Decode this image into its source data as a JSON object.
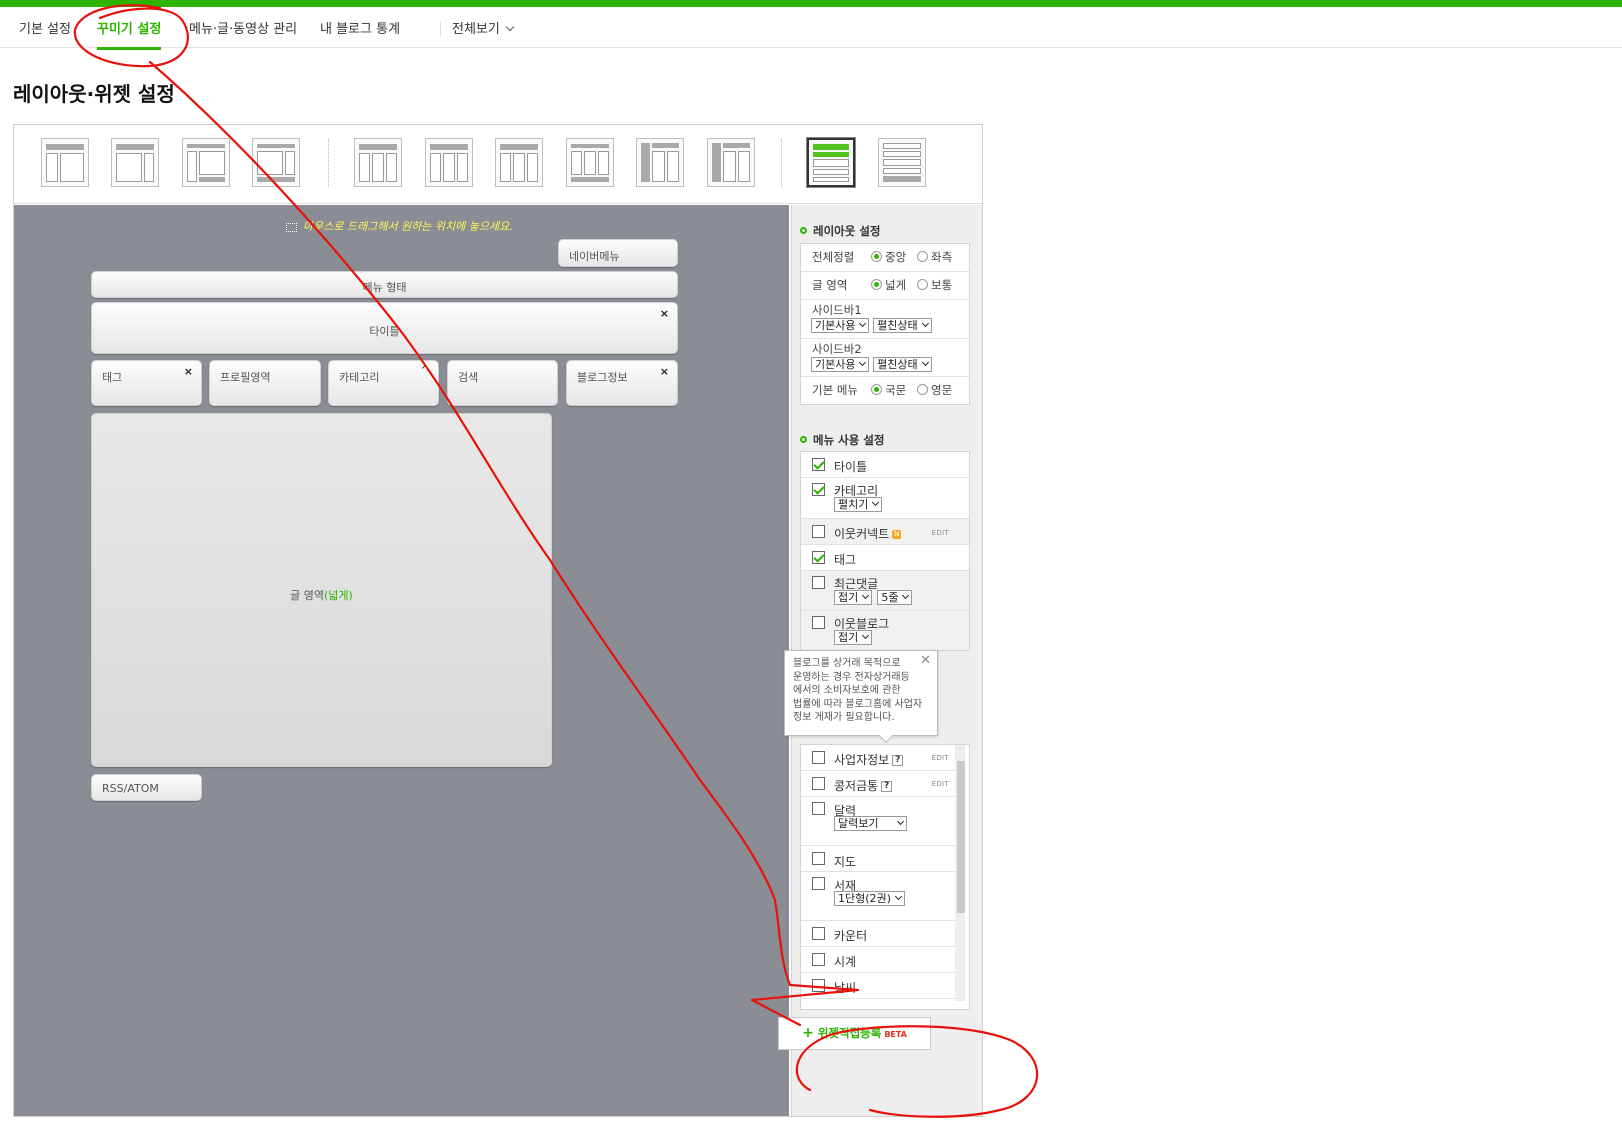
{
  "nav": {
    "tabs": [
      "기본 설정",
      "꾸미기 설정",
      "메뉴·글·동영상 관리",
      "내 블로그 통계"
    ],
    "all_view": "전체보기"
  },
  "page_title": "레이아웃·위젯 설정",
  "canvas": {
    "hint": "마우스로 드래그해서 원하는 위치에 놓으세요.",
    "naver_menu": "네이버메뉴",
    "menu_type": "메뉴 형태",
    "title": "타이틀",
    "tag": "태그",
    "profile": "프로필영역",
    "category": "카테고리",
    "search": "검색",
    "blog_info": "블로그정보",
    "post_area": "글 영역",
    "post_area_mode": "(넓게)",
    "rss": "RSS/ATOM"
  },
  "layout_settings": {
    "header": "레이아웃 설정",
    "align_label": "전체정렬",
    "align_options": [
      "중앙",
      "좌측"
    ],
    "width_label": "글 영역",
    "width_options": [
      "넓게",
      "보통"
    ],
    "sidebar1_label": "사이드바1",
    "sidebar2_label": "사이드바2",
    "sidebar_use": "기본사용",
    "sidebar_state": "펼친상태",
    "menu_lang_label": "기본 메뉴",
    "menu_lang_options": [
      "국문",
      "영문"
    ]
  },
  "menu_settings": {
    "header": "메뉴 사용 설정",
    "title": "타이틀",
    "category": "카테고리",
    "category_mode": "펼치기",
    "neighbor_connect": "이웃커넥트",
    "neighbor_badge": "N",
    "edit": "EDIT",
    "tag": "태그",
    "recent_comments": "최근댓글",
    "recent_comments_mode": "접기",
    "recent_comments_count": "5줄",
    "neighbor_blog": "이웃블로그",
    "neighbor_blog_mode": "접기",
    "business_info": "사업자정보",
    "loan": "콩저금통",
    "calendar": "달력",
    "calendar_mode": "달력보기",
    "map": "지도",
    "bookshelf": "서재",
    "bookshelf_mode": "1단형(2권)",
    "counter": "카운터",
    "clock": "시계",
    "weather": "날씨",
    "qmark": "?"
  },
  "tooltip": "블로그를 상거래 목적으로 운영하는 경우 전자상거래등에서의 소비자보호에 관한 법률에 따라 블로그홈에 사업자 정보 게재가 필요합니다.",
  "tooltip_lines": [
    "블로그를 상거래 목적으로",
    "운영하는 경우 전자상거래등",
    "에서의 소비자보호에 관한",
    "법률에 따라 블로그홈에 사업자",
    "정보 게재가 필요합니다."
  ],
  "widget_button": {
    "label": "위젯직접등록",
    "beta": "BETA",
    "plus": "+"
  },
  "colors": {
    "accent": "#2db400",
    "annotation": "#e8120c",
    "canvas": "#8b8d94"
  }
}
